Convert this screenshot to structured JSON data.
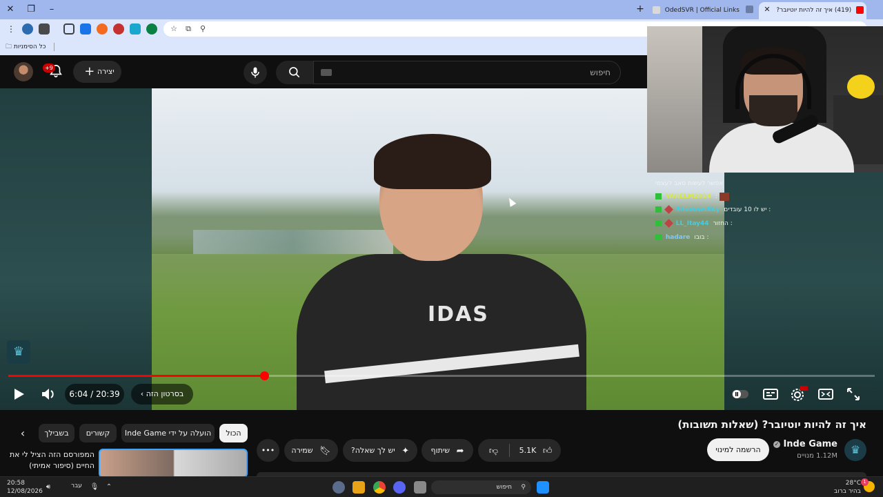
{
  "browser": {
    "tabs": [
      {
        "title": "(419) איך זה להיות יוטיובר?",
        "active": true
      },
      {
        "title": "OdedSVR | Official Links",
        "active": false
      }
    ],
    "bookmarks_label": "כל הסימניות"
  },
  "youtube": {
    "search_placeholder": "חיפוש",
    "create_label": "יצירה",
    "notification_count": "+9",
    "video": {
      "title": "איך זה להיות יוטיובר? (שאלות תשובות)",
      "time_display": "6:04 / 20:39",
      "progress": 0.295,
      "chapter_label": "בסרטון הזה",
      "overlay_text": "IDAS"
    },
    "channel": {
      "name": "Inde Game",
      "subscribers": "1.12M מנויים",
      "subscribe_label": "הרשמה למינוי"
    },
    "actions": {
      "like_count": "5.1K",
      "share_label": "שיתוף",
      "ask_label": "יש לך שאלה?",
      "save_label": "שמירה"
    },
    "chips": [
      {
        "label": "הכול",
        "active": true
      },
      {
        "label": "הועלה על ידי Inde Game",
        "active": false
      },
      {
        "label": "קשורים",
        "active": false
      },
      {
        "label": "בשבילך",
        "active": false
      }
    ],
    "recommended": {
      "title": "המפורסם הזה הציל לי את החיים (סיפור אמיתי)"
    }
  },
  "chat": [
    {
      "user": "",
      "message": "אפשר לעשות סאב לעצמי",
      "color": "#f2f2f2"
    },
    {
      "user": "YAHELM2014",
      "message": ":",
      "color": "#d7e84c"
    },
    {
      "user": "ShadowsSky",
      "message": ": יש לו 10 עובדים",
      "color": "#3ecfe8"
    },
    {
      "user": "LL_Itay44",
      "message": ": החזור",
      "color": "#3ecfe8"
    },
    {
      "user": "hadare",
      "message": ": בובו",
      "color": "#7ec8ff"
    }
  ],
  "taskbar": {
    "time": "20:58",
    "date": "12/08/2026",
    "lang": "עבר",
    "search_placeholder": "חיפוש",
    "weather_temp": "28°C",
    "weather_desc": "בהיר ברוב היום",
    "weather_badge": "1"
  }
}
